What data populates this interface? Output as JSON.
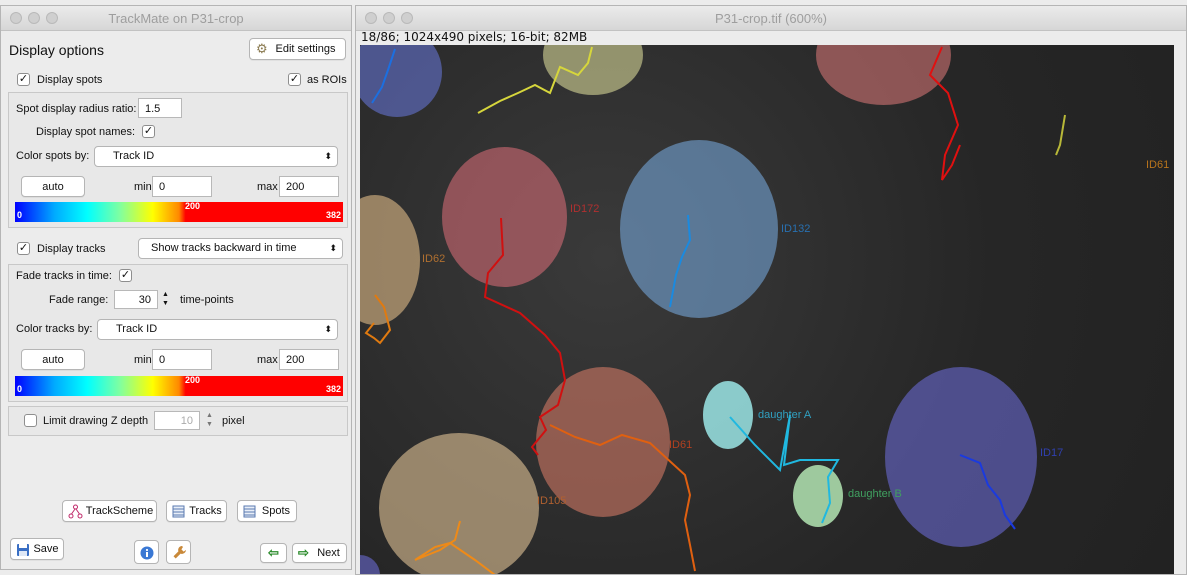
{
  "trackmate": {
    "window_title": "TrackMate on P31-crop",
    "header": "Display options",
    "edit_settings": "Edit settings",
    "display_spots": "Display spots",
    "as_rois": "as ROIs",
    "spot_radius_label": "Spot display radius ratio:",
    "spot_radius_value": "1.5",
    "spot_names_label": "Display spot names:",
    "color_spots_label": "Color spots by:",
    "color_spots_value": "Track ID",
    "auto": "auto",
    "min_label": "min",
    "max_label": "max",
    "spots_min": "0",
    "spots_max": "200",
    "cbar_left": "0",
    "cbar_mid": "200",
    "cbar_right": "382",
    "display_tracks": "Display tracks",
    "track_mode": "Show tracks backward in time",
    "fade_label": "Fade tracks in time:",
    "fade_range_label": "Fade range:",
    "fade_range_value": "30",
    "fade_unit": "time-points",
    "color_tracks_label": "Color tracks by:",
    "color_tracks_value": "Track ID",
    "tracks_min": "0",
    "tracks_max": "200",
    "limit_z": "Limit drawing Z depth",
    "z_value": "10",
    "z_unit": "pixel",
    "trackscheme": "TrackScheme",
    "tracks": "Tracks",
    "spots": "Spots",
    "save": "Save",
    "next": "Next"
  },
  "image": {
    "window_title": "P31-crop.tif (600%)",
    "info": "18/86; 1024x490 pixels; 16-bit; 82MB",
    "labels": [
      "ID61",
      "ID172",
      "ID132",
      "ID62",
      "daughter A",
      "daughter B",
      "ID61",
      "ID105",
      "ID17"
    ]
  },
  "colors": {
    "accent_red": "#ff0000",
    "accent_blue": "#0000ff"
  }
}
